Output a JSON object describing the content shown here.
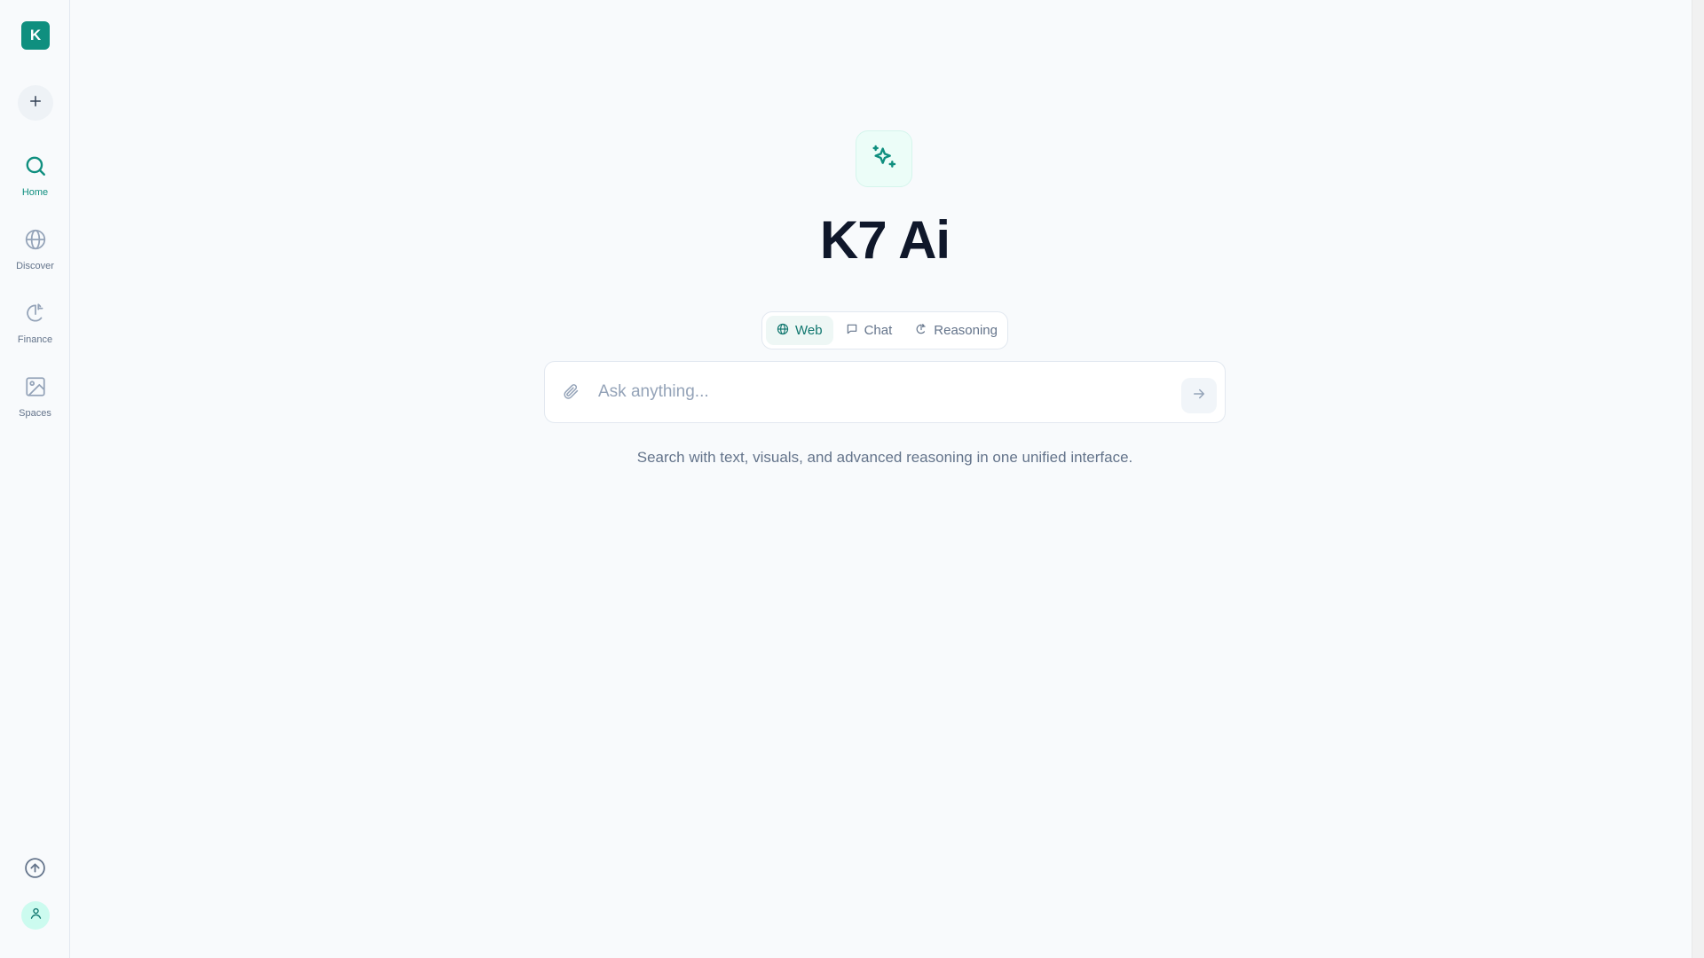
{
  "sidebar": {
    "logo_letter": "K",
    "new_button_icon": "plus-icon",
    "items": [
      {
        "label": "Home",
        "icon": "search-icon",
        "active": true
      },
      {
        "label": "Discover",
        "icon": "globe-icon",
        "active": false
      },
      {
        "label": "Finance",
        "icon": "finance-icon",
        "active": false
      },
      {
        "label": "Spaces",
        "icon": "image-icon",
        "active": false
      }
    ],
    "upgrade_icon": "arrow-up-circle-icon",
    "avatar_icon": "user-icon"
  },
  "main": {
    "hero_icon": "sparkles-icon",
    "title": "K7 Ai",
    "modes": [
      {
        "label": "Web",
        "icon": "globe-icon",
        "active": true
      },
      {
        "label": "Chat",
        "icon": "chat-bubble-icon",
        "active": false
      },
      {
        "label": "Reasoning",
        "icon": "reasoning-icon",
        "active": false
      }
    ],
    "search": {
      "placeholder": "Ask anything...",
      "value": ""
    },
    "subtitle": "Search with text, visuals, and advanced reasoning in one unified interface."
  },
  "colors": {
    "accent": "#0f8f7f",
    "background": "#f8fafc",
    "text_primary": "#0f172a",
    "text_muted": "#64748b"
  }
}
